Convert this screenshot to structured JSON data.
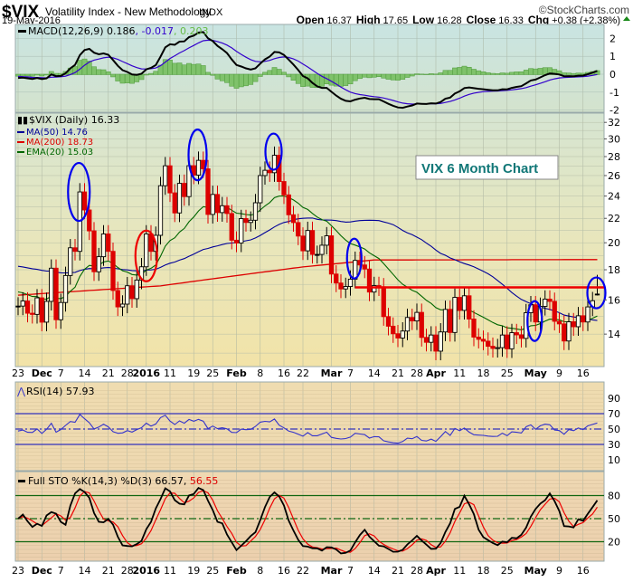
{
  "header": {
    "symbol": "$VIX",
    "name": "Volatility Index - New Methodology",
    "exchange": "INDX",
    "date": "19-May-2016",
    "copyright": "©StockCharts.com",
    "open_label": "Open",
    "open": "16.37",
    "high_label": "High",
    "high": "17.65",
    "low_label": "Low",
    "low": "16.28",
    "close_label": "Close",
    "close": "16.33",
    "chg_label": "Chg",
    "chg": "+0.38 (+2.38%)"
  },
  "colors": {
    "up": "#000000",
    "down": "#dd0000",
    "ma50": "#000099",
    "ma200": "#dd0000",
    "ema20": "#006600",
    "macd": "#000000",
    "signal": "#3300cc",
    "hist": "#7fc26b",
    "rsi": "#3333cc",
    "annot": "#0000ee"
  },
  "chart_data": {
    "type": "candlestick",
    "title": "VIX 6 Month Chart",
    "dates": [
      "Nov 23",
      "Nov 24",
      "Nov 25",
      "Nov 27",
      "Nov 30",
      "Dec 1",
      "Dec 2",
      "Dec 3",
      "Dec 4",
      "Dec 7",
      "Dec 8",
      "Dec 9",
      "Dec 10",
      "Dec 11",
      "Dec 14",
      "Dec 15",
      "Dec 16",
      "Dec 17",
      "Dec 18",
      "Dec 21",
      "Dec 22",
      "Dec 23",
      "Dec 24",
      "Dec 28",
      "Dec 29",
      "Dec 30",
      "Dec 31",
      "Jan 4",
      "Jan 5",
      "Jan 6",
      "Jan 7",
      "Jan 8",
      "Jan 11",
      "Jan 12",
      "Jan 13",
      "Jan 14",
      "Jan 15",
      "Jan 19",
      "Jan 20",
      "Jan 21",
      "Jan 22",
      "Jan 25",
      "Jan 26",
      "Jan 27",
      "Jan 28",
      "Jan 29",
      "Feb 1",
      "Feb 2",
      "Feb 3",
      "Feb 4",
      "Feb 5",
      "Feb 8",
      "Feb 9",
      "Feb 10",
      "Feb 11",
      "Feb 12",
      "Feb 16",
      "Feb 17",
      "Feb 18",
      "Feb 19",
      "Feb 22",
      "Feb 23",
      "Feb 24",
      "Feb 25",
      "Feb 26",
      "Feb 29",
      "Mar 1",
      "Mar 2",
      "Mar 3",
      "Mar 4",
      "Mar 7",
      "Mar 8",
      "Mar 9",
      "Mar 10",
      "Mar 11",
      "Mar 14",
      "Mar 15",
      "Mar 16",
      "Mar 17",
      "Mar 18",
      "Mar 21",
      "Mar 22",
      "Mar 23",
      "Mar 24",
      "Mar 28",
      "Mar 29",
      "Mar 30",
      "Mar 31",
      "Apr 1",
      "Apr 4",
      "Apr 5",
      "Apr 6",
      "Apr 7",
      "Apr 8",
      "Apr 11",
      "Apr 12",
      "Apr 13",
      "Apr 14",
      "Apr 15",
      "Apr 18",
      "Apr 19",
      "Apr 20",
      "Apr 21",
      "Apr 22",
      "Apr 25",
      "Apr 26",
      "Apr 27",
      "Apr 28",
      "Apr 29",
      "May 2",
      "May 3",
      "May 4",
      "May 5",
      "May 6",
      "May 9",
      "May 10",
      "May 11",
      "May 12",
      "May 13",
      "May 16",
      "May 17",
      "May 18",
      "May 19"
    ],
    "close": [
      15.62,
      15.93,
      15.19,
      15.12,
      16.13,
      14.67,
      15.91,
      18.11,
      14.81,
      15.84,
      17.6,
      19.61,
      19.34,
      24.39,
      22.73,
      20.95,
      17.86,
      18.94,
      20.7,
      19.34,
      16.6,
      15.57,
      15.74,
      16.91,
      16.08,
      17.29,
      18.21,
      20.7,
      19.34,
      20.59,
      24.99,
      27.01,
      24.3,
      22.47,
      25.22,
      23.95,
      27.02,
      26.05,
      27.59,
      26.69,
      22.34,
      24.15,
      22.5,
      23.11,
      22.42,
      20.2,
      19.98,
      21.98,
      21.65,
      21.84,
      23.38,
      26.0,
      26.54,
      26.29,
      28.14,
      25.4,
      24.11,
      22.31,
      21.64,
      20.53,
      19.38,
      20.98,
      19.11,
      19.11,
      19.81,
      20.55,
      17.7,
      17.09,
      16.7,
      16.86,
      17.35,
      18.67,
      18.34,
      18.05,
      16.5,
      16.92,
      16.84,
      14.99,
      14.44,
      14.02,
      13.79,
      14.17,
      14.94,
      14.74,
      15.24,
      13.82,
      13.56,
      13.95,
      13.1,
      14.12,
      15.42,
      14.09,
      16.16,
      15.36,
      16.26,
      14.85,
      13.84,
      13.72,
      13.62,
      13.35,
      13.24,
      13.28,
      13.95,
      13.22,
      14.08,
      13.96,
      13.77,
      15.22,
      15.7,
      14.68,
      15.6,
      16.05,
      15.91,
      14.72,
      14.57,
      13.63,
      14.69,
      14.41,
      15.04,
      14.68,
      15.57,
      15.95,
      16.33
    ],
    "last": {
      "open": 16.37,
      "high": 17.65,
      "low": 16.28,
      "close": 16.33
    },
    "ma200_points": [
      [
        0,
        16.3
      ],
      [
        30,
        16.9
      ],
      [
        60,
        18.2
      ],
      [
        75,
        18.7
      ],
      [
        122,
        18.73
      ]
    ],
    "resistance_level": 16.8,
    "price_axis": {
      "scale": "log",
      "ticks": [
        14,
        16,
        18,
        20,
        22,
        24,
        26,
        28,
        30,
        32
      ]
    },
    "overlays_legend": {
      "price": "$VIX (Daily) 16.33",
      "ma50": "MA(50) 14.76",
      "ma200": "MA(200) 18.73",
      "ema20": "EMA(20) 15.03"
    },
    "macd": {
      "label": "MACD(12,26,9) 0.186",
      "signal": ", -0.017",
      "hist": ", 0.203",
      "ticks": [
        "2",
        "1",
        "0",
        "-1",
        "-2"
      ],
      "ylim": [
        -2.5,
        2.5
      ]
    },
    "rsi": {
      "label": "RSI(14) 57.93",
      "ticks": [
        "90",
        "70",
        "50",
        "30",
        "10"
      ],
      "levels": [
        70,
        50,
        30
      ]
    },
    "sto": {
      "label": "Full STO %K(14,3) %D(3) 66.57,",
      "d_label": " 56.55",
      "ticks": [
        "80",
        "50",
        "20"
      ],
      "levels": [
        80,
        50,
        20
      ]
    },
    "date_labels": [
      {
        "i": 0,
        "t": "23",
        "b": false
      },
      {
        "i": 5,
        "t": "Dec",
        "b": true
      },
      {
        "i": 9,
        "t": "7",
        "b": false
      },
      {
        "i": 14,
        "t": "14",
        "b": false
      },
      {
        "i": 19,
        "t": "21",
        "b": false
      },
      {
        "i": 23,
        "t": "28",
        "b": false
      },
      {
        "i": 27,
        "t": "2016",
        "b": true
      },
      {
        "i": 32,
        "t": "11",
        "b": false
      },
      {
        "i": 37,
        "t": "19",
        "b": false
      },
      {
        "i": 41,
        "t": "25",
        "b": false
      },
      {
        "i": 46,
        "t": "Feb",
        "b": true
      },
      {
        "i": 51,
        "t": "8",
        "b": false
      },
      {
        "i": 56,
        "t": "16",
        "b": false
      },
      {
        "i": 60,
        "t": "22",
        "b": false
      },
      {
        "i": 66,
        "t": "Mar",
        "b": true
      },
      {
        "i": 70,
        "t": "7",
        "b": false
      },
      {
        "i": 75,
        "t": "14",
        "b": false
      },
      {
        "i": 80,
        "t": "21",
        "b": false
      },
      {
        "i": 84,
        "t": "28",
        "b": false
      },
      {
        "i": 88,
        "t": "Apr",
        "b": true
      },
      {
        "i": 93,
        "t": "11",
        "b": false
      },
      {
        "i": 98,
        "t": "18",
        "b": false
      },
      {
        "i": 103,
        "t": "25",
        "b": false
      },
      {
        "i": 109,
        "t": "May",
        "b": true
      },
      {
        "i": 114,
        "t": "9",
        "b": false
      },
      {
        "i": 119,
        "t": "16",
        "b": false
      }
    ],
    "annotations": {
      "blue_circles_at": [
        "Dec 11",
        "Jan 20",
        "Feb 11",
        "Mar 8",
        "May 2",
        "May 19"
      ],
      "red_circle_at": "Dec 31"
    }
  }
}
